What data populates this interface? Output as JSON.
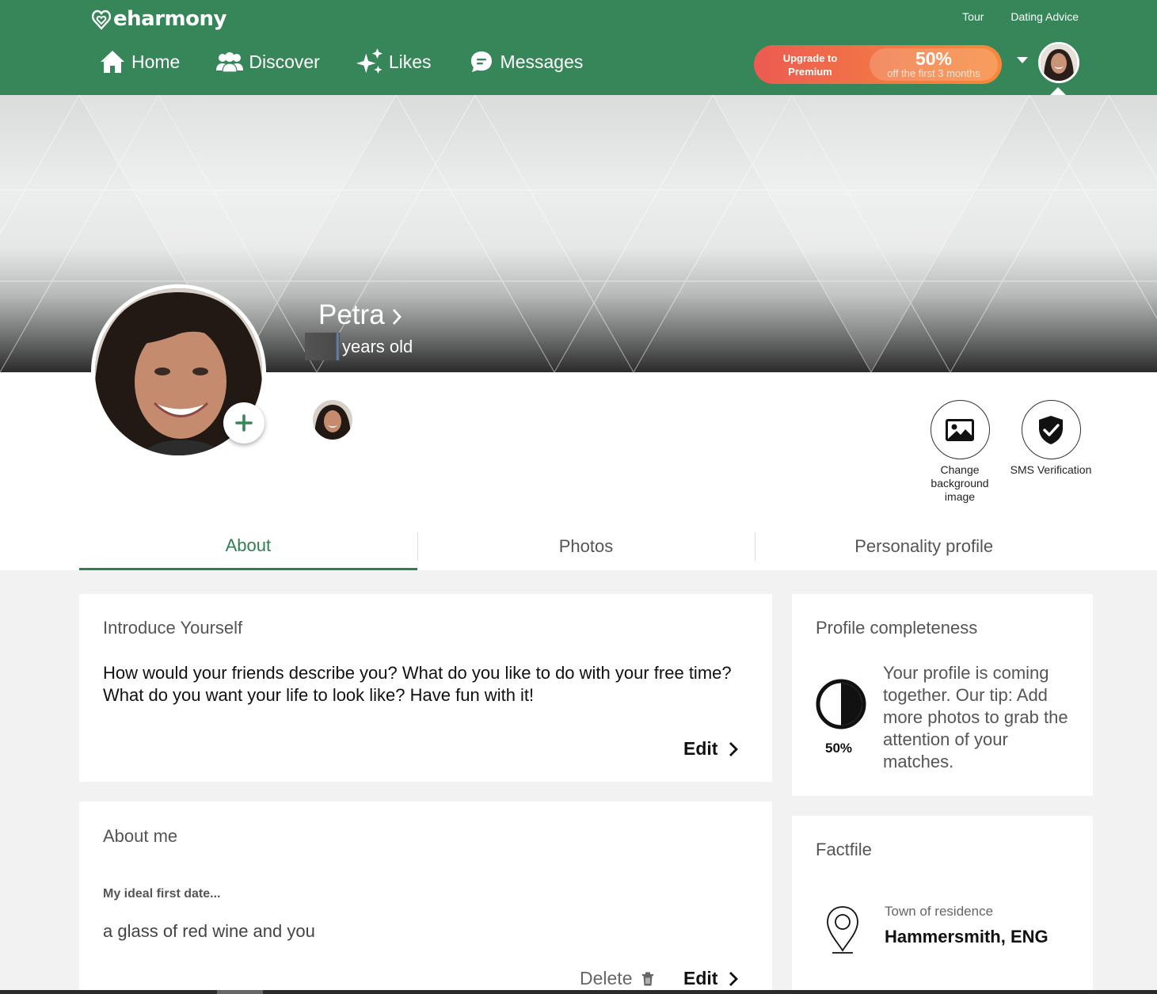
{
  "app": {
    "logo_text": "eharmony"
  },
  "header": {
    "top_links": [
      "Tour",
      "Dating Advice"
    ],
    "nav": [
      {
        "label": "Home",
        "icon": "home-icon"
      },
      {
        "label": "Discover",
        "icon": "people-icon"
      },
      {
        "label": "Likes",
        "icon": "sparkles-icon"
      },
      {
        "label": "Messages",
        "icon": "chat-bubble-icon"
      }
    ],
    "upgrade": {
      "line1": "Upgrade to",
      "line2": "Premium",
      "discount": "50%",
      "discount_note": "off the first 3 months"
    }
  },
  "profile": {
    "name": "Petra",
    "age_suffix": "years old",
    "actions": [
      {
        "label": "Change background image",
        "icon": "image-icon"
      },
      {
        "label": "SMS Verification",
        "icon": "shield-check-icon"
      }
    ]
  },
  "tabs": [
    {
      "label": "About",
      "active": true
    },
    {
      "label": "Photos",
      "active": false
    },
    {
      "label": "Personality profile",
      "active": false
    }
  ],
  "intro_card": {
    "title": "Introduce Yourself",
    "text": "How would your friends describe you? What do you like to do with your free time? What do you want your life to look like? Have fun with it!",
    "edit_label": "Edit"
  },
  "about_card": {
    "title": "About me",
    "question": "My ideal first date...",
    "answer": "a glass of red wine and you",
    "delete_label": "Delete",
    "edit_label": "Edit"
  },
  "completeness_card": {
    "title": "Profile completeness",
    "percent_label": "50%",
    "percent_value": 0.5,
    "tip": "Your profile is coming together. Our tip: Add more photos to grab the attention of your matches."
  },
  "factfile_card": {
    "title": "Factfile",
    "residence_label": "Town of residence",
    "residence_value": "Hammersmith, ENG"
  },
  "colors": {
    "brand_green": "#368659",
    "upgrade_orange": "#f27a42",
    "active_tab": "#2f7f52"
  }
}
